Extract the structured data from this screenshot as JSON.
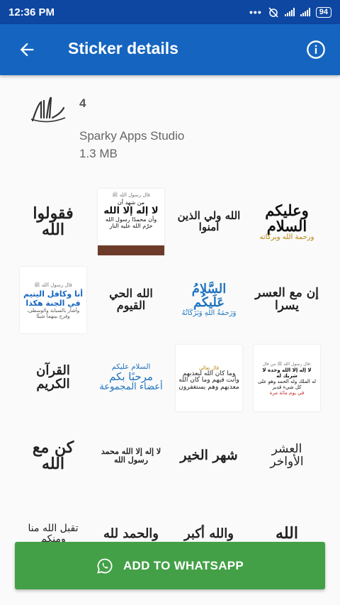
{
  "status_bar": {
    "time": "12:36 PM",
    "battery": "94"
  },
  "app_bar": {
    "title": "Sticker details",
    "back_icon": "arrow-back-icon",
    "info_icon": "info-icon"
  },
  "pack": {
    "name": "4",
    "publisher": "Sparky Apps Studio",
    "size": "1.3 MB"
  },
  "stickers": [
    {
      "text": "فقولوا الله"
    },
    {
      "text": "لا إله إلا الله",
      "header": "قال رسول الله ﷺ",
      "line1": "من شهد أن",
      "line2": "وأن محمدًا رسول الله",
      "line3": "حرّم الله عليه النار"
    },
    {
      "text": "الله ولي الذين آمنوا"
    },
    {
      "text": "وعليكم السلام",
      "line2": "ورحمة الله وبركاته"
    },
    {
      "text": "أنا وكافل اليتيم في الجنة هكذا",
      "header": "قال رسول الله ﷺ",
      "line2": "وأشار بالسبابة والوسطى، وفرج بينهما شيئًا"
    },
    {
      "text": "الله الحي القيوم"
    },
    {
      "text": "السَّلامُ عَلَيكُم",
      "line2": "وَرَحمَةُ اللهِ وَبَرَكَاتُهُ"
    },
    {
      "text": "إن مع العسر يسرا"
    },
    {
      "text": "القرآن الكريم"
    },
    {
      "text": "السلام عليكم",
      "line2": "مرحبًا بكم",
      "line3": "أعضاء المجموعة"
    },
    {
      "text": "وما كان الله ليعذبهم",
      "header": "قال تعالى",
      "line2": "وأنت فيهم وما كان الله",
      "line3": "معذبهم وهم يستغفرون"
    },
    {
      "text": "لا إله إلا الله وحده لا شريك له",
      "header": "قال رسول الله ﷺ من قال:",
      "line2": "له الملك وله الحمد وهو على كل شيء قدير",
      "line3": "في يوم مائة مرة"
    },
    {
      "text": "كن مع الله"
    },
    {
      "text": "لا إله إلا الله محمد رسول الله"
    },
    {
      "text": "شهر الخير"
    },
    {
      "text": "العشر الأواخر"
    },
    {
      "text": "تقبل الله منا ومنكم"
    },
    {
      "text": "والحمد لله"
    },
    {
      "text": "والله أكبر"
    },
    {
      "text": "الله"
    }
  ],
  "add_button": {
    "label": "ADD TO WHATSAPP",
    "icon": "whatsapp-icon",
    "color": "#43a047"
  },
  "colors": {
    "status_bar": "#0d47a1",
    "app_bar": "#1565c0"
  }
}
